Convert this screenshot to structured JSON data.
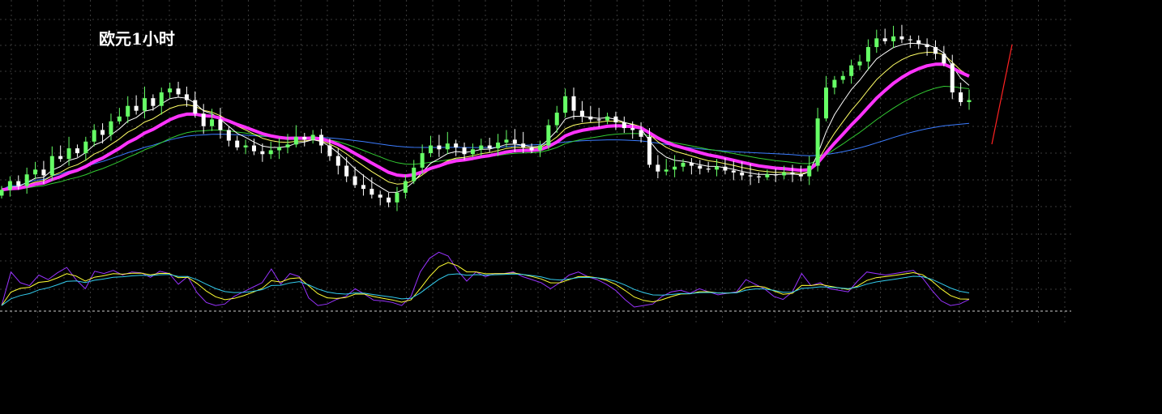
{
  "chart_data": {
    "type": "candlestick",
    "title": "欧元1小时",
    "colors": {
      "up": "#66ff66",
      "down": "#ffffff",
      "ma_thick": "#ff33ff",
      "ma_long": "#3b7cff",
      "ma_mid": "#33cc33",
      "ma_fast": "#ffff66",
      "ma_fastest": "#ffffff",
      "osc_main": "#9933ff",
      "osc_signal": "#ffff33",
      "osc_slow": "#33ccee",
      "grid": "#3a3a3a",
      "trend_line": "#ff2222"
    },
    "price_close": [
      1.3015,
      1.3024,
      1.3019,
      1.3031,
      1.3036,
      1.303,
      1.305,
      1.3047,
      1.3058,
      1.3053,
      1.3065,
      1.3077,
      1.3072,
      1.3086,
      1.3091,
      1.3102,
      1.3097,
      1.311,
      1.3102,
      1.3116,
      1.312,
      1.3114,
      1.3108,
      1.3094,
      1.3081,
      1.3088,
      1.3077,
      1.3066,
      1.3059,
      1.3061,
      1.3055,
      1.3052,
      1.3056,
      1.3059,
      1.3062,
      1.307,
      1.3067,
      1.3072,
      1.3061,
      1.305,
      1.304,
      1.3029,
      1.302,
      1.3016,
      1.301,
      1.3007,
      1.3002,
      1.3012,
      1.3024,
      1.3038,
      1.3053,
      1.3061,
      1.3057,
      1.3063,
      1.3059,
      1.3052,
      1.3057,
      1.3061,
      1.3058,
      1.3064,
      1.3067,
      1.3063,
      1.3059,
      1.3056,
      1.3061,
      1.3082,
      1.3095,
      1.3112,
      1.3097,
      1.3091,
      1.3088,
      1.3087,
      1.3091,
      1.3085,
      1.3079,
      1.3077,
      1.307,
      1.3041,
      1.3034,
      1.3036,
      1.3039,
      1.3043,
      1.304,
      1.3037,
      1.3036,
      1.3039,
      1.3035,
      1.3033,
      1.303,
      1.3029,
      1.3028,
      1.3031,
      1.303,
      1.3033,
      1.3031,
      1.3029,
      1.304,
      1.3089,
      1.3121,
      1.3129,
      1.3133,
      1.3144,
      1.3148,
      1.3163,
      1.3172,
      1.3169,
      1.3174,
      1.3171,
      1.317,
      1.3166,
      1.3163,
      1.3156,
      1.3146,
      1.3116,
      1.3106,
      1.3108
    ],
    "osc_main": [
      18,
      62,
      48,
      44,
      58,
      52,
      61,
      68,
      52,
      40,
      63,
      60,
      64,
      58,
      62,
      61,
      55,
      63,
      60,
      46,
      56,
      35,
      22,
      18,
      20,
      30,
      36,
      42,
      48,
      66,
      46,
      60,
      56,
      28,
      18,
      20,
      26,
      30,
      40,
      33,
      25,
      24,
      22,
      18,
      30,
      62,
      80,
      88,
      83,
      64,
      50,
      62,
      56,
      60,
      60,
      62,
      56,
      52,
      48,
      40,
      48,
      58,
      62,
      56,
      52,
      46,
      38,
      26,
      16,
      18,
      20,
      30,
      36,
      38,
      34,
      40,
      36,
      32,
      34,
      36,
      52,
      46,
      40,
      30,
      26,
      36,
      60,
      44,
      48,
      40,
      38,
      36,
      50,
      62,
      60,
      58,
      60,
      62,
      64,
      54,
      38,
      24,
      18,
      20,
      26
    ]
  }
}
